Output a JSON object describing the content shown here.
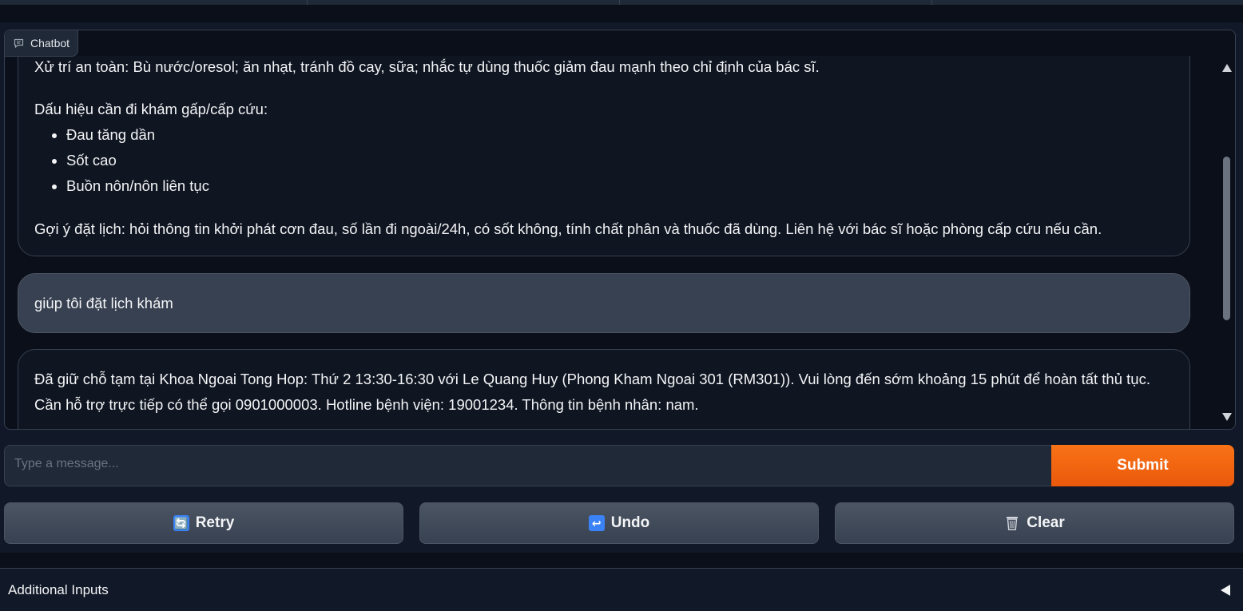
{
  "chatbot": {
    "label": "Chatbot",
    "messages": {
      "bot_1": {
        "safety": "Xử trí an toàn: Bù nước/oresol; ăn nhạt, tránh đồ cay, sữa; nhắc tự dùng thuốc giảm đau mạnh theo chỉ định của bác sĩ.",
        "signs_heading": "Dấu hiệu cần đi khám gấp/cấp cứu:",
        "signs": [
          "Đau tăng dần",
          "Sốt cao",
          "Buồn nôn/nôn liên tục"
        ],
        "suggestion": "Gợi ý đặt lịch: hỏi thông tin khởi phát cơn đau, số lần đi ngoài/24h, có sốt không, tính chất phân và thuốc đã dùng. Liên hệ với bác sĩ hoặc phòng cấp cứu nếu cần."
      },
      "user_1": "giúp tôi đặt lịch khám",
      "bot_2": "Đã giữ chỗ tạm tại Khoa Ngoai Tong Hop: Thứ 2 13:30-16:30 với Le Quang Huy (Phong Kham Ngoai 301 (RM301)). Vui lòng đến sớm khoảng 15 phút để hoàn tất thủ tục. Cần hỗ trợ trực tiếp có thể gọi 0901000003. Hotline bệnh viện: 19001234. Thông tin bệnh nhân: nam."
    }
  },
  "input": {
    "placeholder": "Type a message...",
    "value": ""
  },
  "buttons": {
    "submit": "Submit",
    "retry": "Retry",
    "undo": "Undo",
    "clear": "Clear"
  },
  "icons": {
    "chatbot": "chat-bubble-icon",
    "retry": "retry-arrows-icon",
    "undo": "undo-arrow-icon",
    "clear": "wastebasket-icon",
    "accordion": "triangle-left-icon"
  },
  "additional_inputs": {
    "label": "Additional Inputs"
  },
  "colors": {
    "accent": "#f97316",
    "background": "#0b0f19",
    "panel": "#111827"
  }
}
